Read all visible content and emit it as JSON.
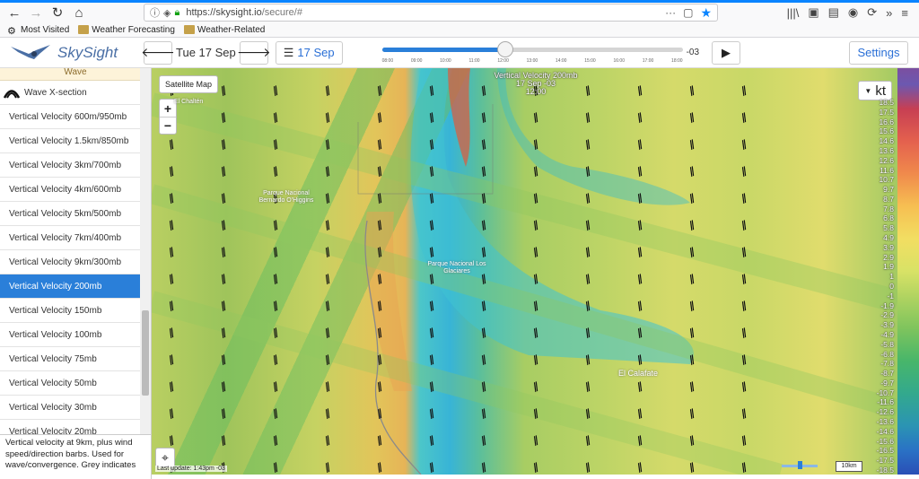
{
  "browser": {
    "url_host": "https://skysight.io",
    "url_path": "/secure/#",
    "bookmarks": [
      {
        "label": "Most Visited",
        "icon": "gear-icon"
      },
      {
        "label": "Weather Forecasting",
        "icon": "folder-icon"
      },
      {
        "label": "Weather-Related",
        "icon": "folder-icon"
      }
    ]
  },
  "header": {
    "app_name": "SkySight",
    "date_label": "Tue 17 Sep",
    "day_button": "17 Sep",
    "settings_label": "Settings",
    "timezone": "-03",
    "time_ticks": [
      "08:00",
      "09:00",
      "10:00",
      "11:00",
      "12:00",
      "13:00",
      "14:00",
      "15:00",
      "16:00",
      "17:00",
      "18:00"
    ],
    "slider_value_fraction": 0.41
  },
  "sidebar": {
    "top_item": "Wave",
    "section_item": "Wave X-section",
    "items": [
      "Vertical Velocity 600m/950mb",
      "Vertical Velocity 1.5km/850mb",
      "Vertical Velocity 3km/700mb",
      "Vertical Velocity 4km/600mb",
      "Vertical Velocity 5km/500mb",
      "Vertical Velocity 7km/400mb",
      "Vertical Velocity 9km/300mb",
      "Vertical Velocity 200mb",
      "Vertical Velocity 150mb",
      "Vertical Velocity 100mb",
      "Vertical Velocity 75mb",
      "Vertical Velocity 50mb",
      "Vertical Velocity 30mb",
      "Vertical Velocity 20mb"
    ],
    "active_index": 7,
    "description": "Vertical velocity at 9km, plus wind speed/direction barbs. Used for wave/convergence. Grey indicates"
  },
  "map": {
    "satellite_label": "Satellite Map",
    "zoom_in": "+",
    "zoom_out": "−",
    "title_line1": "Vertical Velocity 200mb",
    "title_line2": "17 Sep -03",
    "title_line3": "12:00",
    "unit": "kt",
    "last_update": "Last update: 1:43pm -03",
    "scale": "10km",
    "places": [
      {
        "name": "El Calafate"
      },
      {
        "name": "Parque Nacional Los Glaciares"
      },
      {
        "name": "Parque Nacional Bernardo O'Higgins"
      },
      {
        "name": "El Chaltén"
      }
    ]
  },
  "legend": {
    "labels": [
      "18.5",
      "17.5",
      "16.6",
      "15.6",
      "14.6",
      "13.6",
      "12.6",
      "11.6",
      "10.7",
      "9.7",
      "8.7",
      "7.8",
      "6.8",
      "5.8",
      "4.9",
      "3.9",
      "2.9",
      "1.9",
      "1",
      "0",
      "-1",
      "-1.9",
      "-2.9",
      "-3.9",
      "-4.9",
      "-5.8",
      "-6.8",
      "-7.8",
      "-8.7",
      "-9.7",
      "-10.7",
      "-11.6",
      "-12.6",
      "-13.6",
      "-14.6",
      "-15.6",
      "-16.5",
      "-17.5",
      "-18.5"
    ]
  }
}
